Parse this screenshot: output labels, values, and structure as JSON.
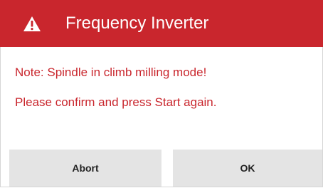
{
  "dialog": {
    "title": "Frequency Inverter",
    "icon": "warning-triangle-icon",
    "messages": [
      "Note: Spindle in climb milling mode!",
      "Please confirm and press Start again."
    ],
    "buttons": {
      "abort_label": "Abort",
      "ok_label": "OK"
    }
  },
  "colors": {
    "accent": "#c9262d",
    "button_bg": "#e4e4e4",
    "title_text": "#ffffff"
  }
}
